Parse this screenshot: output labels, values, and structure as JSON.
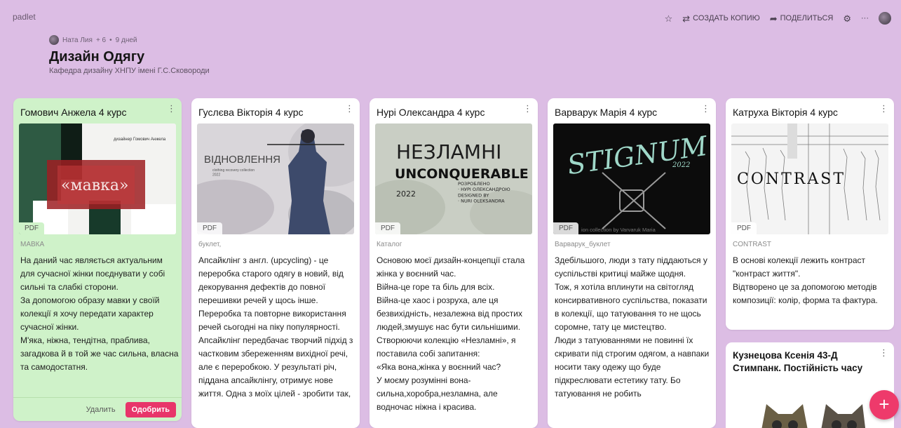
{
  "app": {
    "brand": "padlet"
  },
  "toolbar": {
    "copy_label": "СОЗДАТЬ КОПИЮ",
    "share_label": "ПОДЕЛИТЬСЯ",
    "more_label": "···"
  },
  "header": {
    "author": "Ната Лия",
    "likes": "+ 6",
    "age": "9 дней",
    "title": "Дизайн Одягу",
    "subtitle": "Кафедра дизайну ХНПУ імені Г.С.Сковороди"
  },
  "cards": [
    {
      "title": "Гомович Анжела 4 курс",
      "badge": "PDF",
      "subtitle": "МАВКА",
      "thumb_text": "«мавка»",
      "thumb_small": "дизайнер Гомович Анжела",
      "body": "На даний час являється актуальним для сучасної жінки поєднувати у собі сильні та слабкі сторони.\nЗа допомогою образу мавки у своїй колекції я хочу передати характер сучасної жінки.\nМ'яка, ніжна, тендітна, праблива, загадкова й в той же час сильна, власна та самодостатня.",
      "delete_label": "Удалить",
      "approve_label": "Одобрить"
    },
    {
      "title": "Гуслєва Вікторія 4 курс",
      "badge": "PDF",
      "subtitle": "буклет,",
      "thumb_text": "ВІДНОВЛЕННЯ",
      "thumb_small": "clothing recovery collection\n2022",
      "body": "Апсайклінг з англ.  (upcycling) - це переробка старого одягу в новий, від декорування дефектів до повної перешивки речей у щось інше.  Переробка та повторне використання речей сьогодні на піку популярності.  Апсайклінг передбачає творчий підхід з частковим збереженням вихідної речі, але є переробкою.  У результаті річ, піддана апсайклінгу, отримує нове життя. Одна з моїх цілей - зробити так,"
    },
    {
      "title": "Нурі Олександра 4 курс",
      "badge": "PDF",
      "subtitle": "Каталог",
      "thumb_text": "НЕЗЛАМНІ",
      "thumb_text2": "UNCONQUERABLE",
      "thumb_small": "2022",
      "thumb_small2": "РОЗРОБЛЕНО\n· НУРІ ОЛЕКСАНДРОЮ\nDESIGNED BY\n· NURI OLEKSANDRA",
      "body": "Основою моєї дизайн-концепції стала жінка у воєнний час.\nВійна-це горе та біль для всіх.\nВійна-це хаос і розруха, але ця безвихідність, незалежна від простих людей,змушує нас бути сильнішими.\nСтворюючи колекцію «Незламні», я поставила собі запитання:\n«Яка вона,жінка у воєнний час?\nУ моєму розумінні вона-сильна,хоробра,незламна, але водночас ніжна і красива."
    },
    {
      "title": "Варварук Марія 4 курс",
      "badge": "PDF",
      "subtitle": "Варварук_буклет",
      "thumb_text": "STIGNUM",
      "thumb_small": "2022",
      "thumb_small2": "ion collection by Varvaruk Maria",
      "body": "Здебільшого, люди з тату піддаються у суспільстві критиці майже щодня.\nТож, я хотіла вплинути на світогляд консирвативного суспільства, показати в колекції, що татуювання то не щось соромне, тату це мистецтво.\nЛюди з татуюваннями не повинні їх скривати під строгим одягом, а навпаки носити таку одежу що буде підкреслювати естетику тату. Бо татуювання не робить"
    },
    {
      "title": "Катруха Вікторія 4 курс",
      "badge": "PDF",
      "subtitle": "CONTRAST",
      "thumb_text": "CONTRAST",
      "body": "В основі колекції лежить контраст \"контраст життя\".\nВідтворено це за допомогою методів композиції: колір, форма та фактура."
    }
  ],
  "card_extra": {
    "title": "Кузнецова Ксенія 43-Д Стимпанк. Постійність часу"
  },
  "fab": {
    "label": "+"
  }
}
